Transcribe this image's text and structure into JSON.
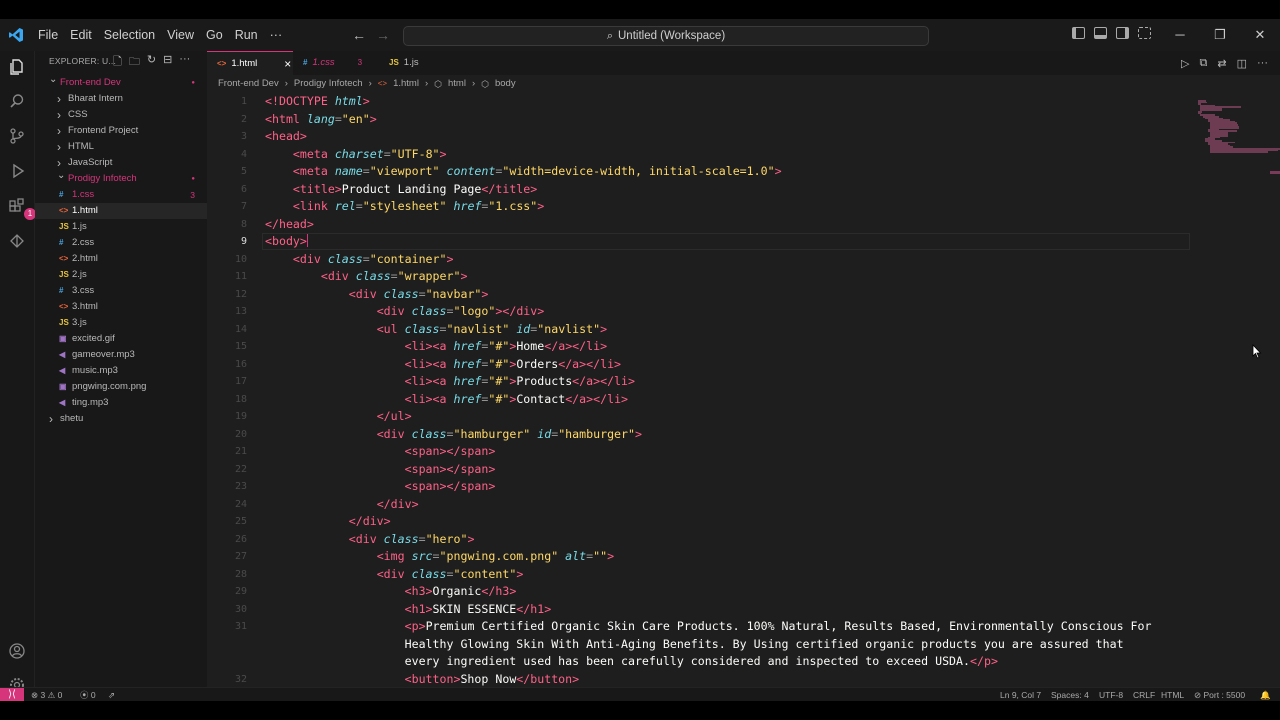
{
  "app": {
    "menu": [
      "File",
      "Edit",
      "Selection",
      "View",
      "Go",
      "Run",
      "···"
    ],
    "command_center": "Untitled (Workspace)",
    "accent": "#d6357c"
  },
  "activity_bar": {
    "extensions_badge": "1"
  },
  "explorer": {
    "header": "EXPLORER: U...",
    "tree": [
      {
        "label": "Front-end Dev",
        "level": 0,
        "type": "folder",
        "open": true,
        "color": "#d6357c",
        "dot": true
      },
      {
        "label": "Bharat Intern",
        "level": 1,
        "type": "folder",
        "open": false
      },
      {
        "label": "CSS",
        "level": 1,
        "type": "folder",
        "open": false
      },
      {
        "label": "Frontend Project",
        "level": 1,
        "type": "folder",
        "open": false
      },
      {
        "label": "HTML",
        "level": 1,
        "type": "folder",
        "open": false
      },
      {
        "label": "JavaScript",
        "level": 1,
        "type": "folder",
        "open": false
      },
      {
        "label": "Prodigy Infotech",
        "level": 1,
        "type": "folder",
        "open": true,
        "color": "#d6357c",
        "dot": true
      },
      {
        "label": "1.css",
        "level": 2,
        "type": "css",
        "color": "#d6357c",
        "count": "3"
      },
      {
        "label": "1.html",
        "level": 2,
        "type": "html",
        "selected": true
      },
      {
        "label": "1.js",
        "level": 2,
        "type": "js"
      },
      {
        "label": "2.css",
        "level": 2,
        "type": "css"
      },
      {
        "label": "2.html",
        "level": 2,
        "type": "html"
      },
      {
        "label": "2.js",
        "level": 2,
        "type": "js"
      },
      {
        "label": "3.css",
        "level": 2,
        "type": "css"
      },
      {
        "label": "3.html",
        "level": 2,
        "type": "html"
      },
      {
        "label": "3.js",
        "level": 2,
        "type": "js"
      },
      {
        "label": "excited.gif",
        "level": 2,
        "type": "img"
      },
      {
        "label": "gameover.mp3",
        "level": 2,
        "type": "audio"
      },
      {
        "label": "music.mp3",
        "level": 2,
        "type": "audio"
      },
      {
        "label": "pngwing.com.png",
        "level": 2,
        "type": "img"
      },
      {
        "label": "ting.mp3",
        "level": 2,
        "type": "audio"
      },
      {
        "label": "shetu",
        "level": 0,
        "type": "folder",
        "open": false
      }
    ]
  },
  "tabs": [
    {
      "label": "1.html",
      "icon": "<>",
      "active": true,
      "close": "×"
    },
    {
      "label": "1.css",
      "icon": "#",
      "count": "3",
      "error": true
    },
    {
      "label": "1.js",
      "icon": "JS"
    }
  ],
  "breadcrumb": [
    "Front-end Dev",
    "Prodigy Infotech",
    "1.html",
    "html",
    "body"
  ],
  "code": {
    "current_line": 9,
    "line_numbers": [
      "1",
      "2",
      "3",
      "4",
      "5",
      "6",
      "7",
      "8",
      "9",
      "10",
      "11",
      "12",
      "13",
      "14",
      "15",
      "16",
      "17",
      "18",
      "19",
      "20",
      "21",
      "22",
      "23",
      "24",
      "25",
      "26",
      "27",
      "28",
      "29",
      "30",
      "31",
      "",
      "",
      "32"
    ],
    "lines": [
      [
        [
          "t",
          "<!DOCTYPE "
        ],
        [
          "a",
          "html"
        ],
        [
          "t",
          ">"
        ]
      ],
      [
        [
          "t",
          "<html "
        ],
        [
          "a",
          "lang"
        ],
        [
          "p",
          "="
        ],
        [
          "s",
          "\"en\""
        ],
        [
          "t",
          ">"
        ]
      ],
      [
        [
          "t",
          "<head>"
        ]
      ],
      [
        [
          "sp",
          "    "
        ],
        [
          "t",
          "<meta "
        ],
        [
          "a",
          "charset"
        ],
        [
          "p",
          "="
        ],
        [
          "s",
          "\"UTF-8\""
        ],
        [
          "t",
          ">"
        ]
      ],
      [
        [
          "sp",
          "    "
        ],
        [
          "t",
          "<meta "
        ],
        [
          "a",
          "name"
        ],
        [
          "p",
          "="
        ],
        [
          "s",
          "\"viewport\" "
        ],
        [
          "a",
          "content"
        ],
        [
          "p",
          "="
        ],
        [
          "s",
          "\"width=device-width, initial-scale=1.0\""
        ],
        [
          "t",
          ">"
        ]
      ],
      [
        [
          "sp",
          "    "
        ],
        [
          "t",
          "<title>"
        ],
        [
          "tx",
          "Product Landing Page"
        ],
        [
          "t",
          "</title>"
        ]
      ],
      [
        [
          "sp",
          "    "
        ],
        [
          "t",
          "<link "
        ],
        [
          "a",
          "rel"
        ],
        [
          "p",
          "="
        ],
        [
          "s",
          "\"stylesheet\" "
        ],
        [
          "a",
          "href"
        ],
        [
          "p",
          "="
        ],
        [
          "s",
          "\"1.css\""
        ],
        [
          "t",
          ">"
        ]
      ],
      [
        [
          "t",
          "</head>"
        ]
      ],
      [
        [
          "t",
          "<body>"
        ]
      ],
      [
        [
          "sp",
          "    "
        ],
        [
          "t",
          "<div "
        ],
        [
          "a",
          "class"
        ],
        [
          "p",
          "="
        ],
        [
          "s",
          "\"container\""
        ],
        [
          "t",
          ">"
        ]
      ],
      [
        [
          "sp",
          "        "
        ],
        [
          "t",
          "<div "
        ],
        [
          "a",
          "class"
        ],
        [
          "p",
          "="
        ],
        [
          "s",
          "\"wrapper\""
        ],
        [
          "t",
          ">"
        ]
      ],
      [
        [
          "sp",
          "            "
        ],
        [
          "t",
          "<div "
        ],
        [
          "a",
          "class"
        ],
        [
          "p",
          "="
        ],
        [
          "s",
          "\"navbar\""
        ],
        [
          "t",
          ">"
        ]
      ],
      [
        [
          "sp",
          "                "
        ],
        [
          "t",
          "<div "
        ],
        [
          "a",
          "class"
        ],
        [
          "p",
          "="
        ],
        [
          "s",
          "\"logo\""
        ],
        [
          "t",
          "></div>"
        ]
      ],
      [
        [
          "sp",
          "                "
        ],
        [
          "t",
          "<ul "
        ],
        [
          "a",
          "class"
        ],
        [
          "p",
          "="
        ],
        [
          "s",
          "\"navlist\" "
        ],
        [
          "a",
          "id"
        ],
        [
          "p",
          "="
        ],
        [
          "s",
          "\"navlist\""
        ],
        [
          "t",
          ">"
        ]
      ],
      [
        [
          "sp",
          "                    "
        ],
        [
          "t",
          "<li><a "
        ],
        [
          "a",
          "href"
        ],
        [
          "p",
          "="
        ],
        [
          "s",
          "\"#\""
        ],
        [
          "t",
          ">"
        ],
        [
          "tx",
          "Home"
        ],
        [
          "t",
          "</a></li>"
        ]
      ],
      [
        [
          "sp",
          "                    "
        ],
        [
          "t",
          "<li><a "
        ],
        [
          "a",
          "href"
        ],
        [
          "p",
          "="
        ],
        [
          "s",
          "\"#\""
        ],
        [
          "t",
          ">"
        ],
        [
          "tx",
          "Orders"
        ],
        [
          "t",
          "</a></li>"
        ]
      ],
      [
        [
          "sp",
          "                    "
        ],
        [
          "t",
          "<li><a "
        ],
        [
          "a",
          "href"
        ],
        [
          "p",
          "="
        ],
        [
          "s",
          "\"#\""
        ],
        [
          "t",
          ">"
        ],
        [
          "tx",
          "Products"
        ],
        [
          "t",
          "</a></li>"
        ]
      ],
      [
        [
          "sp",
          "                    "
        ],
        [
          "t",
          "<li><a "
        ],
        [
          "a",
          "href"
        ],
        [
          "p",
          "="
        ],
        [
          "s",
          "\"#\""
        ],
        [
          "t",
          ">"
        ],
        [
          "tx",
          "Contact"
        ],
        [
          "t",
          "</a></li>"
        ]
      ],
      [
        [
          "sp",
          "                "
        ],
        [
          "t",
          "</ul>"
        ]
      ],
      [
        [
          "sp",
          "                "
        ],
        [
          "t",
          "<div "
        ],
        [
          "a",
          "class"
        ],
        [
          "p",
          "="
        ],
        [
          "s",
          "\"hamburger\" "
        ],
        [
          "a",
          "id"
        ],
        [
          "p",
          "="
        ],
        [
          "s",
          "\"hamburger\""
        ],
        [
          "t",
          ">"
        ]
      ],
      [
        [
          "sp",
          "                    "
        ],
        [
          "t",
          "<span></span>"
        ]
      ],
      [
        [
          "sp",
          "                    "
        ],
        [
          "t",
          "<span></span>"
        ]
      ],
      [
        [
          "sp",
          "                    "
        ],
        [
          "t",
          "<span></span>"
        ]
      ],
      [
        [
          "sp",
          "                "
        ],
        [
          "t",
          "</div>"
        ]
      ],
      [
        [
          "sp",
          "            "
        ],
        [
          "t",
          "</div>"
        ]
      ],
      [
        [
          "sp",
          "            "
        ],
        [
          "t",
          "<div "
        ],
        [
          "a",
          "class"
        ],
        [
          "p",
          "="
        ],
        [
          "s",
          "\"hero\""
        ],
        [
          "t",
          ">"
        ]
      ],
      [
        [
          "sp",
          "                "
        ],
        [
          "t",
          "<img "
        ],
        [
          "a",
          "src"
        ],
        [
          "p",
          "="
        ],
        [
          "s",
          "\"pngwing.com.png\" "
        ],
        [
          "a",
          "alt"
        ],
        [
          "p",
          "="
        ],
        [
          "s",
          "\"\""
        ],
        [
          "t",
          ">"
        ]
      ],
      [
        [
          "sp",
          "                "
        ],
        [
          "t",
          "<div "
        ],
        [
          "a",
          "class"
        ],
        [
          "p",
          "="
        ],
        [
          "s",
          "\"content\""
        ],
        [
          "t",
          ">"
        ]
      ],
      [
        [
          "sp",
          "                    "
        ],
        [
          "t",
          "<h3>"
        ],
        [
          "tx",
          "Organic"
        ],
        [
          "t",
          "</h3>"
        ]
      ],
      [
        [
          "sp",
          "                    "
        ],
        [
          "t",
          "<h1>"
        ],
        [
          "tx",
          "SKIN ESSENCE"
        ],
        [
          "t",
          "</h1>"
        ]
      ],
      [
        [
          "sp",
          "                    "
        ],
        [
          "t",
          "<p>"
        ],
        [
          "tx",
          "Premium Certified Organic Skin Care Products. 100% Natural, Results Based, Environmentally Conscious For"
        ]
      ],
      [
        [
          "sp",
          "                    "
        ],
        [
          "tx",
          "Healthy Glowing Skin With Anti-Aging Benefits. By Using certified organic products you are assured that"
        ]
      ],
      [
        [
          "sp",
          "                    "
        ],
        [
          "tx",
          "every ingredient used has been carefully considered and inspected to exceed USDA."
        ],
        [
          "t",
          "</p>"
        ]
      ],
      [
        [
          "sp",
          "                    "
        ],
        [
          "t",
          "<button>"
        ],
        [
          "tx",
          "Shop Now"
        ],
        [
          "t",
          "</button>"
        ]
      ]
    ]
  },
  "statusbar": {
    "errors": "3",
    "warnings": "0",
    "ports": "0",
    "position": "Ln 9, Col 7",
    "spaces": "Spaces: 4",
    "encoding": "UTF-8",
    "eol": "CRLF",
    "language": "HTML",
    "port": "Port : 5500"
  }
}
